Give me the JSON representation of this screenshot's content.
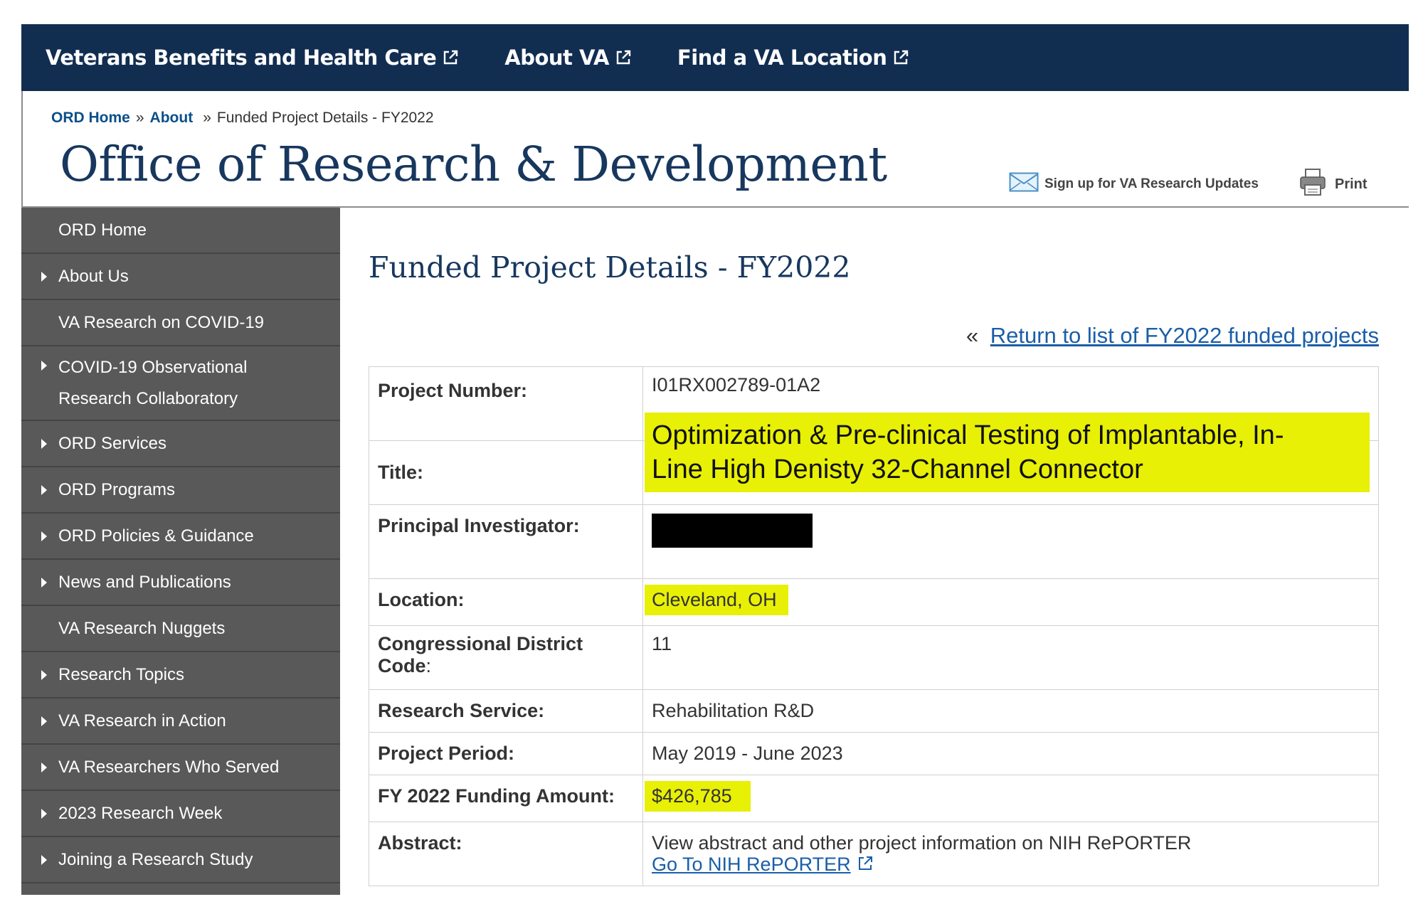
{
  "topnav": {
    "items": [
      {
        "label": "Veterans Benefits and Health Care"
      },
      {
        "label": "About VA"
      },
      {
        "label": "Find a VA Location"
      }
    ]
  },
  "breadcrumb": {
    "home": "ORD Home",
    "sep1": "»",
    "about": "About",
    "sep2": "»",
    "current": "Funded Project Details - FY2022"
  },
  "header": {
    "title": "Office of Research & Development",
    "signup": "Sign up for VA Research  Updates",
    "print": "Print"
  },
  "sidebar": {
    "items": [
      {
        "label": "ORD Home"
      },
      {
        "label": "About Us"
      },
      {
        "label": "VA Research on COVID-19"
      },
      {
        "label": "COVID-19 Observational Research Collaboratory"
      },
      {
        "label": "ORD Services"
      },
      {
        "label": "ORD Programs"
      },
      {
        "label": "ORD Policies & Guidance"
      },
      {
        "label": "News and Publications"
      },
      {
        "label": "VA Research Nuggets"
      },
      {
        "label": "Research Topics"
      },
      {
        "label": "VA Research in Action"
      },
      {
        "label": "VA Researchers Who Served"
      },
      {
        "label": "2023 Research Week"
      },
      {
        "label": "Joining a Research Study"
      }
    ]
  },
  "main": {
    "heading": "Funded Project Details - FY2022",
    "return_quote": "«",
    "return_link": "Return to list of FY2022 funded projects",
    "rows": {
      "project_number": {
        "label": "Project Number:",
        "value": "I01RX002789-01A2"
      },
      "title": {
        "label": "Title:",
        "value": "Optimization & Pre-clinical Testing of Implantable, In-Line High Denisty 32-Channel Connector"
      },
      "pi": {
        "label": "Principal Investigator:"
      },
      "location": {
        "label": "Location:",
        "value": "Cleveland, OH"
      },
      "district": {
        "label": "Congressional District Code",
        "colon": ":",
        "value": "11"
      },
      "service": {
        "label": "Research Service:",
        "value": "Rehabilitation R&D"
      },
      "period": {
        "label": "Project Period:",
        "value": "May 2019 - June 2023"
      },
      "funding": {
        "label": "FY 2022 Funding Amount:",
        "value": "$426,785"
      },
      "abstract": {
        "label": "Abstract:",
        "value": "View abstract and other project information on NIH RePORTER",
        "link": "Go To NIH RePORTER"
      }
    }
  },
  "colors": {
    "nav_bg": "#112e51",
    "title_blue": "#17375e",
    "sidebar_item": "#595959",
    "sidebar_bg": "#444444",
    "highlight": "#e8f006",
    "link": "#1a5ea8"
  }
}
